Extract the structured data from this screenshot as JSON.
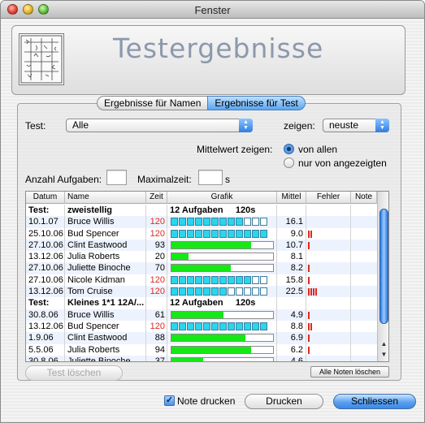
{
  "window": {
    "title": "Fenster"
  },
  "header": {
    "title": "Testergebnisse"
  },
  "tabs": [
    {
      "label": "Ergebnisse für Namen",
      "active": false
    },
    {
      "label": "Ergebnisse für Test",
      "active": true
    }
  ],
  "filters": {
    "test_label": "Test:",
    "test_value": "Alle",
    "show_label": "zeigen:",
    "show_value": "neuste",
    "mean_label": "Mittelwert zeigen:",
    "mean_options": [
      {
        "label": "von allen",
        "selected": true
      },
      {
        "label": "nur von angezeigten",
        "selected": false
      }
    ],
    "task_count_label": "Anzahl Aufgaben:",
    "task_count_value": "",
    "max_time_label": "Maximalzeit:",
    "max_time_value": "",
    "max_time_unit": "s"
  },
  "table": {
    "columns": [
      "Datum",
      "Name",
      "Zeit",
      "Grafik",
      "Mittel",
      "Fehler",
      "Note"
    ],
    "rows": [
      {
        "kind": "group",
        "date": "Test:",
        "name": "zweistellig",
        "info": "12 Aufgaben     120s"
      },
      {
        "kind": "entry",
        "date": "10.1.07",
        "name": "Bruce Willis",
        "time": "120",
        "time_red": true,
        "segments": 12,
        "filled": 9,
        "mean": "16.1",
        "errors": 0
      },
      {
        "kind": "entry",
        "date": "25.10.06",
        "name": "Bud Spencer",
        "time": "120",
        "time_red": true,
        "segments": 12,
        "filled": 12,
        "mean": "9.0",
        "errors": 2
      },
      {
        "kind": "entry",
        "date": "27.10.06",
        "name": "Clint Eastwood",
        "time": "93",
        "time_red": false,
        "progress": 0.78,
        "mean": "10.7",
        "errors": 1
      },
      {
        "kind": "entry",
        "date": "13.12.06",
        "name": "Julia Roberts",
        "time": "20",
        "time_red": false,
        "progress": 0.17,
        "mean": "8.1",
        "errors": 0
      },
      {
        "kind": "entry",
        "date": "27.10.06",
        "name": "Juliette Binoche",
        "time": "70",
        "time_red": false,
        "progress": 0.58,
        "mean": "8.2",
        "errors": 1
      },
      {
        "kind": "entry",
        "date": "27.10.06",
        "name": "Nicole Kidman",
        "time": "120",
        "time_red": true,
        "segments": 12,
        "filled": 10,
        "mean": "15.8",
        "errors": 1
      },
      {
        "kind": "entry",
        "date": "13.12.06",
        "name": "Tom Cruise",
        "time": "120",
        "time_red": true,
        "segments": 12,
        "filled": 7,
        "mean": "22.5",
        "errors": 4
      },
      {
        "kind": "group",
        "date": "Test:",
        "name": "Kleines 1*1 12A/...",
        "info": "12 Aufgaben     120s"
      },
      {
        "kind": "entry",
        "date": "30.8.06",
        "name": "Bruce Willis",
        "time": "61",
        "time_red": false,
        "progress": 0.51,
        "mean": "4.9",
        "errors": 1
      },
      {
        "kind": "entry",
        "date": "13.12.06",
        "name": "Bud Spencer",
        "time": "120",
        "time_red": true,
        "segments": 12,
        "filled": 12,
        "mean": "8.8",
        "errors": 2
      },
      {
        "kind": "entry",
        "date": "1.9.06",
        "name": "Clint Eastwood",
        "time": "88",
        "time_red": false,
        "progress": 0.73,
        "mean": "6.9",
        "errors": 1
      },
      {
        "kind": "entry",
        "date": "5.5.06",
        "name": "Julia Roberts",
        "time": "94",
        "time_red": false,
        "progress": 0.78,
        "mean": "6.2",
        "errors": 1
      },
      {
        "kind": "entry",
        "date": "30.8.06",
        "name": "Juliette Binoche",
        "time": "37",
        "time_red": false,
        "progress": 0.31,
        "mean": "4.6",
        "errors": 0
      }
    ]
  },
  "buttons": {
    "delete_test": "Test löschen",
    "delete_all_grades": "Alle Noten löschen",
    "print_grade_label": "Note drucken",
    "print_grade_checked": true,
    "print": "Drucken",
    "close": "Schliessen"
  },
  "colors": {
    "accent": "#3d88e6",
    "bar_green": "#16e816",
    "segment_cyan": "#2ad6ec",
    "error_red": "#e0281e"
  }
}
